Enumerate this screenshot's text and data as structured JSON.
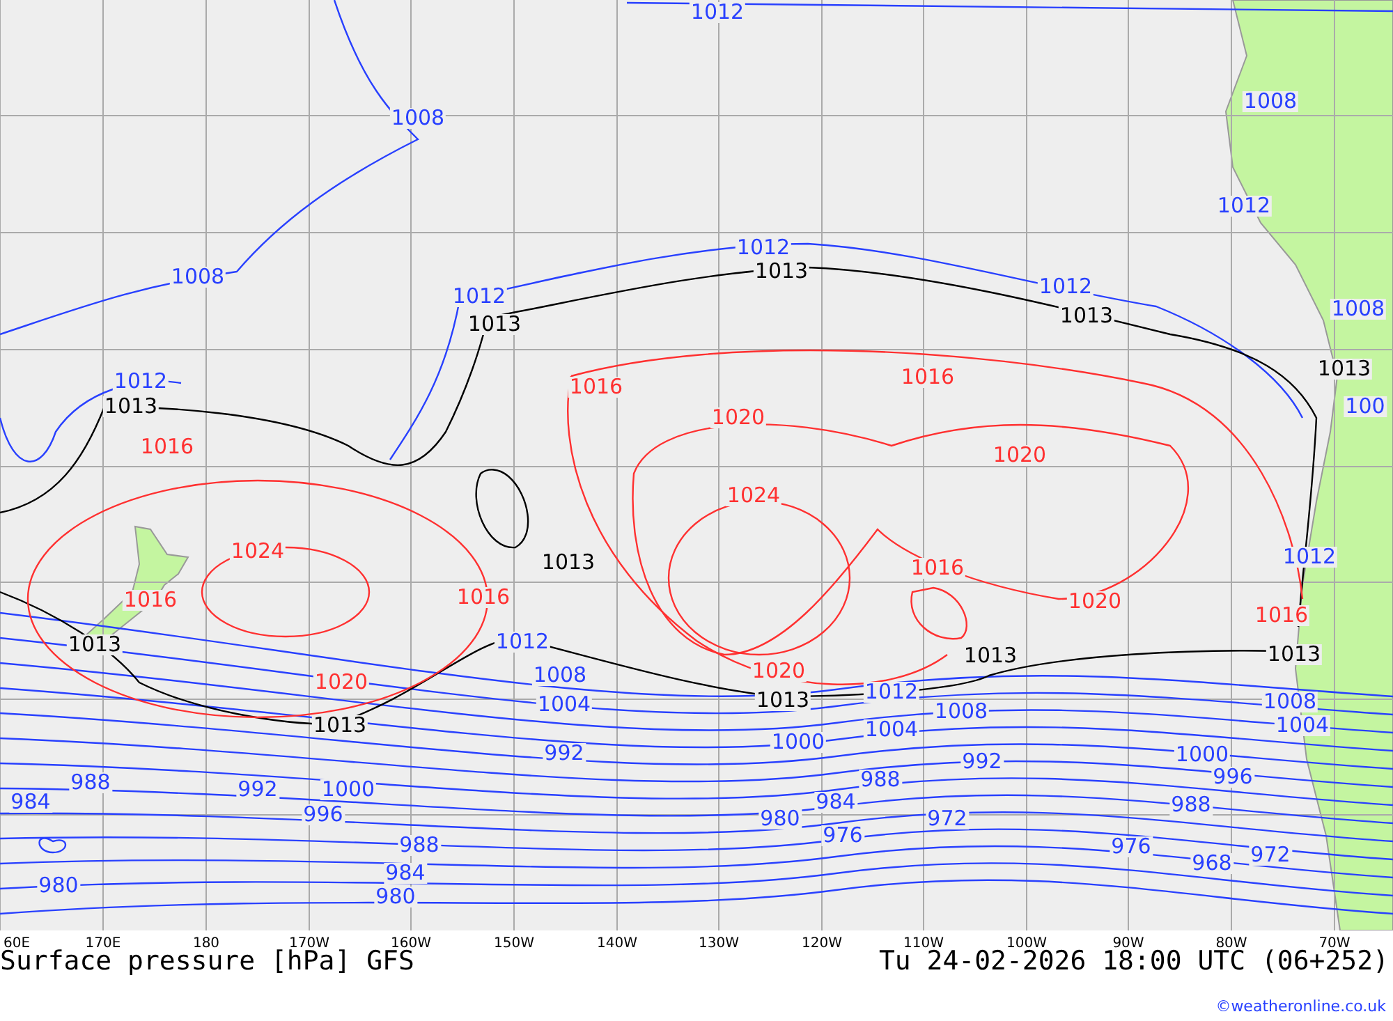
{
  "map": {
    "longitude_ticks": [
      "60E",
      "170E",
      "180",
      "170W",
      "160W",
      "150W",
      "140W",
      "130W",
      "120W",
      "110W",
      "100W",
      "90W",
      "80W",
      "70W"
    ],
    "isobar_labels": [
      {
        "text": "1012",
        "color": "#2840ff"
      },
      {
        "text": "1008",
        "color": "#2840ff"
      },
      {
        "text": "1008",
        "color": "#2840ff"
      },
      {
        "text": "1012",
        "color": "#2840ff"
      },
      {
        "text": "1012",
        "color": "#2840ff"
      },
      {
        "text": "1012",
        "color": "#2840ff"
      },
      {
        "text": "1012",
        "color": "#2840ff"
      },
      {
        "text": "1008",
        "color": "#2840ff"
      },
      {
        "text": "1012",
        "color": "#2840ff"
      },
      {
        "text": "1008",
        "color": "#2840ff"
      },
      {
        "text": "1012",
        "color": "#2840ff"
      },
      {
        "text": "1012",
        "color": "#2840ff"
      },
      {
        "text": "1008",
        "color": "#2840ff"
      },
      {
        "text": "1004",
        "color": "#2840ff"
      },
      {
        "text": "1000",
        "color": "#2840ff"
      },
      {
        "text": "992",
        "color": "#2840ff"
      },
      {
        "text": "992",
        "color": "#2840ff"
      },
      {
        "text": "988",
        "color": "#2840ff"
      },
      {
        "text": "984",
        "color": "#2840ff"
      },
      {
        "text": "980",
        "color": "#2840ff"
      },
      {
        "text": "976",
        "color": "#2840ff"
      },
      {
        "text": "972",
        "color": "#2840ff"
      },
      {
        "text": "1004",
        "color": "#2840ff"
      },
      {
        "text": "1008",
        "color": "#2840ff"
      },
      {
        "text": "1012",
        "color": "#2840ff"
      },
      {
        "text": "1000",
        "color": "#2840ff"
      },
      {
        "text": "996",
        "color": "#2840ff"
      },
      {
        "text": "992",
        "color": "#2840ff"
      },
      {
        "text": "988",
        "color": "#2840ff"
      },
      {
        "text": "984",
        "color": "#2840ff"
      },
      {
        "text": "980",
        "color": "#2840ff"
      },
      {
        "text": "988",
        "color": "#2840ff"
      },
      {
        "text": "984",
        "color": "#2840ff"
      },
      {
        "text": "980",
        "color": "#2840ff"
      },
      {
        "text": "1000",
        "color": "#2840ff"
      },
      {
        "text": "996",
        "color": "#2840ff"
      },
      {
        "text": "988",
        "color": "#2840ff"
      },
      {
        "text": "976",
        "color": "#2840ff"
      },
      {
        "text": "968",
        "color": "#2840ff"
      },
      {
        "text": "972",
        "color": "#2840ff"
      },
      {
        "text": "1008",
        "color": "#2840ff"
      },
      {
        "text": "1004",
        "color": "#2840ff"
      },
      {
        "text": "100",
        "color": "#2840ff"
      },
      {
        "text": "1013",
        "color": "#000000"
      },
      {
        "text": "1013",
        "color": "#000000"
      },
      {
        "text": "1013",
        "color": "#000000"
      },
      {
        "text": "1013",
        "color": "#000000"
      },
      {
        "text": "1013",
        "color": "#000000"
      },
      {
        "text": "1013",
        "color": "#000000"
      },
      {
        "text": "1013",
        "color": "#000000"
      },
      {
        "text": "1013",
        "color": "#000000"
      },
      {
        "text": "1013",
        "color": "#000000"
      },
      {
        "text": "1013",
        "color": "#000000"
      },
      {
        "text": "1013",
        "color": "#000000"
      },
      {
        "text": "1016",
        "color": "#ff3030"
      },
      {
        "text": "1016",
        "color": "#ff3030"
      },
      {
        "text": "1016",
        "color": "#ff3030"
      },
      {
        "text": "1020",
        "color": "#ff3030"
      },
      {
        "text": "1020",
        "color": "#ff3030"
      },
      {
        "text": "1024",
        "color": "#ff3030"
      },
      {
        "text": "1024",
        "color": "#ff3030"
      },
      {
        "text": "1016",
        "color": "#ff3030"
      },
      {
        "text": "1016",
        "color": "#ff3030"
      },
      {
        "text": "1016",
        "color": "#ff3030"
      },
      {
        "text": "1020",
        "color": "#ff3030"
      },
      {
        "text": "1020",
        "color": "#ff3030"
      },
      {
        "text": "1020",
        "color": "#ff3030"
      },
      {
        "text": "1016",
        "color": "#ff3030"
      }
    ]
  },
  "title": "Surface pressure [hPa] GFS",
  "timestamp": "Tu 24-02-2026 18:00 UTC (06+252)",
  "credit": "©weatheronline.co.uk"
}
